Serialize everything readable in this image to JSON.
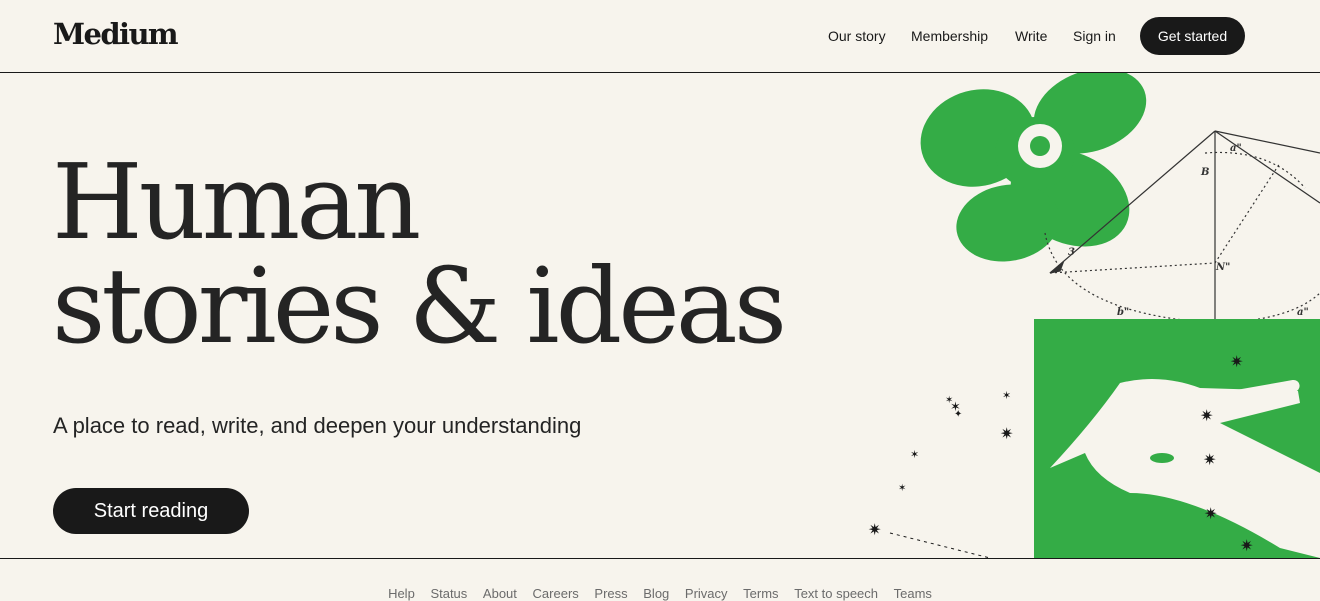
{
  "header": {
    "logo": "Medium",
    "nav": {
      "our_story": "Our story",
      "membership": "Membership",
      "write": "Write",
      "sign_in": "Sign in"
    },
    "get_started": "Get started"
  },
  "hero": {
    "title_line1": "Human",
    "title_line2": "stories & ideas",
    "subtitle": "A place to read, write, and deepen your understanding",
    "cta": "Start reading"
  },
  "footer": {
    "links": [
      "Help",
      "Status",
      "About",
      "Careers",
      "Press",
      "Blog",
      "Privacy",
      "Terms",
      "Text to speech",
      "Teams"
    ]
  },
  "colors": {
    "background": "#f7f4ed",
    "dark": "#191919",
    "green": "#34ac46"
  }
}
